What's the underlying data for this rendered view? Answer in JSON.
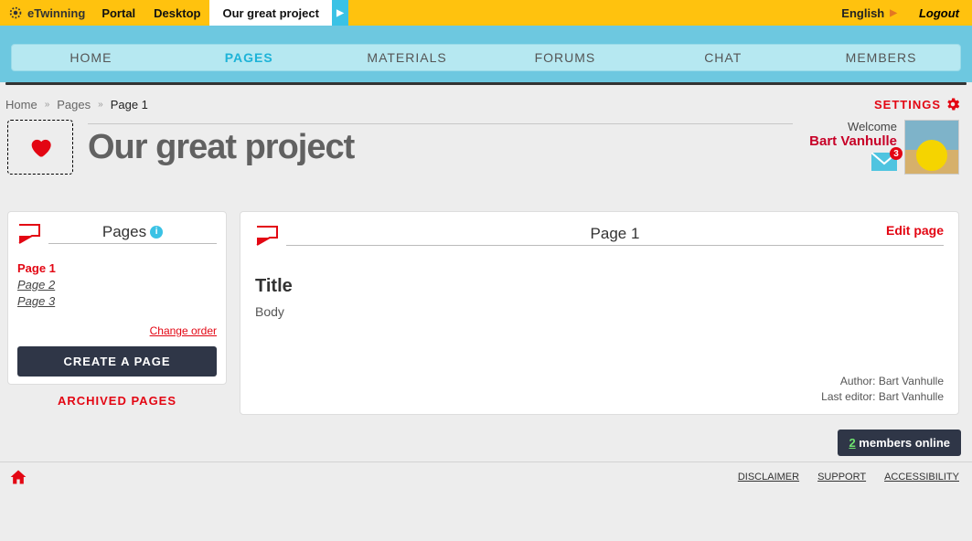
{
  "topbar": {
    "brand": "eTwinning",
    "portal": "Portal",
    "desktop": "Desktop",
    "project_tab": "Our great project",
    "language": "English",
    "logout": "Logout"
  },
  "nav": {
    "home": "HOME",
    "pages": "PAGES",
    "materials": "MATERIALS",
    "forums": "FORUMS",
    "chat": "CHAT",
    "members": "MEMBERS"
  },
  "breadcrumb": {
    "home": "Home",
    "pages": "Pages",
    "current": "Page 1"
  },
  "settings_label": "SETTINGS",
  "project_title": "Our great project",
  "user": {
    "welcome": "Welcome",
    "name": "Bart Vanhulle",
    "mail_count": "3"
  },
  "sidebar": {
    "title": "Pages",
    "items": [
      "Page 1",
      "Page 2",
      "Page 3"
    ],
    "change_order": "Change order",
    "create": "CREATE A PAGE",
    "archived": "ARCHIVED PAGES"
  },
  "page": {
    "heading": "Page 1",
    "edit": "Edit page",
    "title_label": "Title",
    "body_label": "Body",
    "author_line": "Author: Bart Vanhulle",
    "editor_line": "Last editor: Bart Vanhulle"
  },
  "footer": {
    "members_count": "2",
    "members_text": "members online",
    "disclaimer": "DISCLAIMER",
    "support": "SUPPORT",
    "accessibility": "ACCESSIBILITY"
  }
}
